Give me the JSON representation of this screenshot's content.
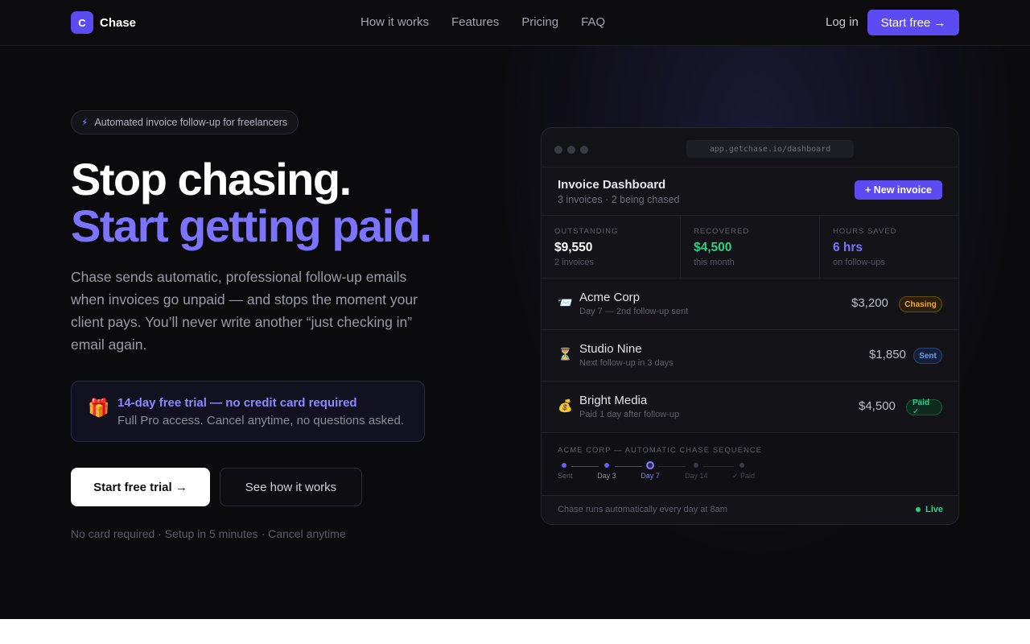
{
  "nav": {
    "brand_initial": "C",
    "brand": "Chase",
    "links": [
      "How it works",
      "Features",
      "Pricing",
      "FAQ"
    ],
    "login": "Log in",
    "cta": "Start free →"
  },
  "hero": {
    "pill_icon": "⚡",
    "pill": "Automated invoice follow-up for freelancers",
    "headline_1": "Stop chasing.",
    "headline_2": "Start getting paid.",
    "lead": "Chase sends automatic, professional follow-up emails when invoices go unpaid — and stops the moment your client pays. You’ll never write another “just checking in” email again.",
    "trial_icon": "🎁",
    "trial_title": "14-day free trial — no credit card required",
    "trial_sub": "Full Pro access. Cancel anytime, no questions asked.",
    "primary_cta": "Start free trial →",
    "secondary_cta": "See how it works",
    "fineprint": "No card required · Setup in 5 minutes · Cancel anytime"
  },
  "dashboard": {
    "url": "app.getchase.io/dashboard",
    "title": "Invoice Dashboard",
    "subtitle": "3 invoices · 2 being chased",
    "new_invoice": "+ New invoice",
    "stats": [
      {
        "label": "OUTSTANDING",
        "value": "$9,550",
        "sub": "2 invoices",
        "color": "#ffffff"
      },
      {
        "label": "RECOVERED",
        "value": "$4,500",
        "sub": "this month",
        "color": "#2ed18a"
      },
      {
        "label": "HOURS SAVED",
        "value": "6 hrs",
        "sub": "on follow-ups",
        "color": "#7c74ff"
      }
    ],
    "invoices": [
      {
        "icon": "📨",
        "client": "Acme Corp",
        "detail": "Day 7 — 2nd follow-up sent",
        "amount": "$3,200",
        "status": "Chasing"
      },
      {
        "icon": "⏳",
        "client": "Studio Nine",
        "detail": "Next follow-up in 3 days",
        "amount": "$1,850",
        "status": "Sent"
      },
      {
        "icon": "💰",
        "client": "Bright Media",
        "detail": "Paid 1 day after follow-up",
        "amount": "$4,500",
        "status": "Paid ✓"
      }
    ],
    "sequence_label": "ACME CORP — AUTOMATIC CHASE SEQUENCE",
    "sequence_steps": [
      "Sent",
      "Day 3",
      "Day 7",
      "Day 14",
      "✓ Paid"
    ],
    "footer": "Chase runs automatically every day at 8am",
    "live": "Live"
  }
}
